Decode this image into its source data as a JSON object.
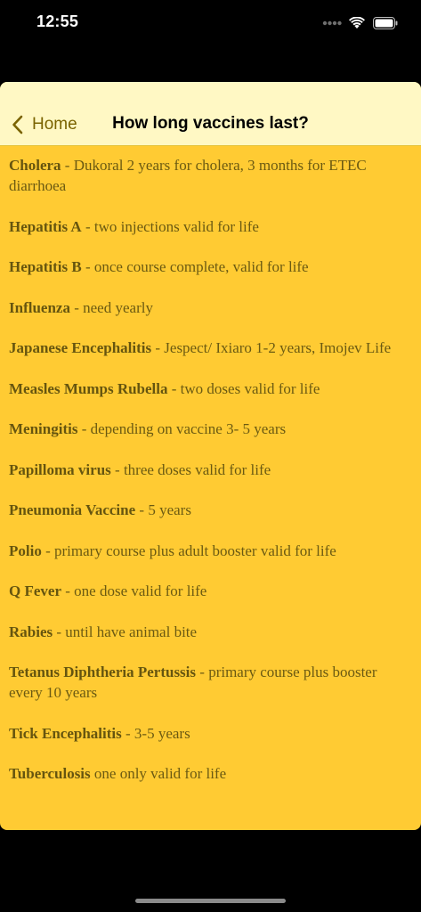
{
  "status_bar": {
    "time": "12:55",
    "icons": [
      "cellular-signal-icon",
      "wifi-icon",
      "battery-icon"
    ]
  },
  "navbar": {
    "back_label": "Home",
    "title": "How long vaccines last?"
  },
  "colors": {
    "background": "#000000",
    "sheet": "#ffcb33",
    "navbar": "#fff8c4",
    "text": "#6b5a12"
  },
  "vaccines": [
    {
      "name": "Cholera",
      "sep": " - ",
      "detail": "Dukoral 2 years for cholera, 3 months for ETEC diarrhoea"
    },
    {
      "name": "Hepatitis A",
      "sep": " - ",
      "detail": "two injections valid for life"
    },
    {
      "name": "Hepatitis B",
      "sep": " - ",
      "detail": "once course complete, valid for life"
    },
    {
      "name": "Influenza",
      "sep": " - ",
      "detail": "need yearly"
    },
    {
      "name": "Japanese Encephalitis",
      "sep": " - ",
      "detail": "Jespect/ Ixiaro 1-2 years, Imojev Life"
    },
    {
      "name": "Measles Mumps Rubella",
      "sep": " - ",
      "detail": "two doses valid for life"
    },
    {
      "name": "Meningitis",
      "sep": " - ",
      "detail": "depending on vaccine 3- 5 years"
    },
    {
      "name": "Papilloma virus",
      "sep": " - ",
      "detail": "three doses valid for life"
    },
    {
      "name": "Pneumonia Vaccine",
      "sep": " - ",
      "detail": "5 years"
    },
    {
      "name": "Polio",
      "sep": " - ",
      "detail": "primary course plus adult booster valid for life"
    },
    {
      "name": "Q Fever",
      "sep": " - ",
      "detail": "one dose valid for life"
    },
    {
      "name": "Rabies",
      "sep": " - ",
      "detail": "until have animal bite"
    },
    {
      "name": "Tetanus Diphtheria Pertussis",
      "sep": " - ",
      "detail": "primary course plus booster every 10 years"
    },
    {
      "name": "Tick Encephalitis",
      "sep": " - ",
      "detail": "3-5 years"
    },
    {
      "name": "Tuberculosis",
      "sep": " ",
      "detail": "one only valid for life"
    }
  ]
}
